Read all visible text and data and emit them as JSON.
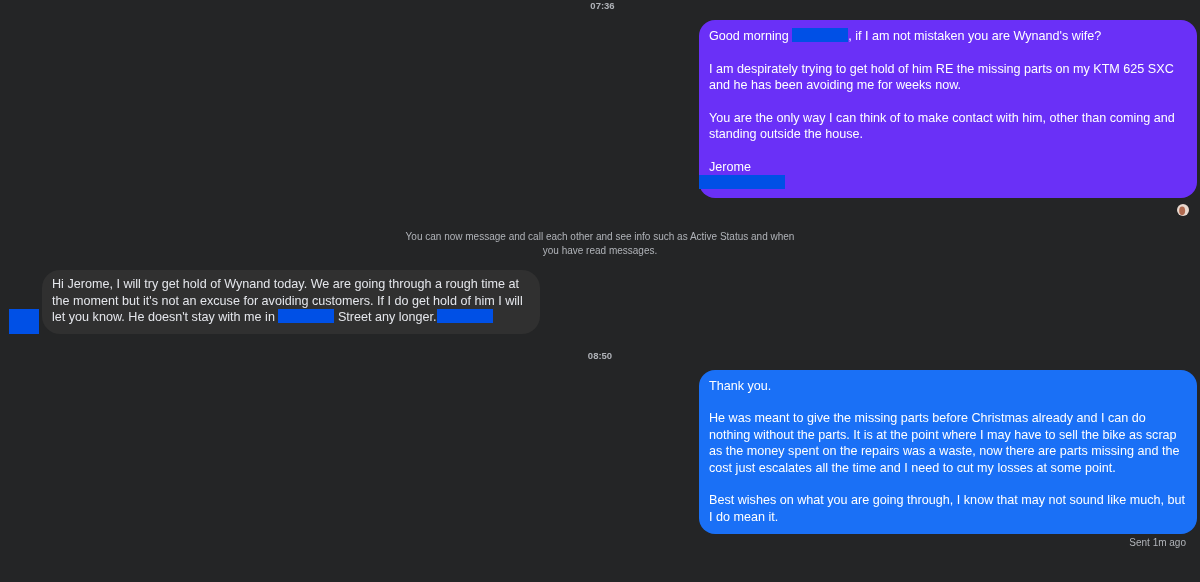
{
  "messages": [
    {
      "kind": "timestamp",
      "text": "07:36"
    },
    {
      "kind": "sent",
      "color": "#6a30f7",
      "paragraphs": [
        [
          {
            "kind": "text",
            "text": "Good morning "
          },
          {
            "kind": "redaction"
          },
          {
            "kind": "text",
            "text": ", if I am not mistaken you are Wynand's wife?"
          }
        ],
        [
          {
            "kind": "text",
            "text": "I am despirately trying to get hold of him RE the missing parts on my KTM 625 SXC and he has been avoiding me for weeks now."
          }
        ],
        [
          {
            "kind": "text",
            "text": "You are the only way I can think of to make contact with him, other than coming and standing outside the house."
          }
        ],
        [
          {
            "kind": "text",
            "text": "Jerome"
          }
        ],
        [
          {
            "kind": "redaction"
          }
        ]
      ]
    },
    {
      "kind": "read_receipt"
    },
    {
      "kind": "notice",
      "text": "You can now message and call each other and see info such as Active Status and when you have read messages."
    },
    {
      "kind": "received",
      "paragraphs": [
        [
          {
            "kind": "text",
            "text": "Hi Jerome, I will try get hold of Wynand today. We are going through a rough time at the moment but it's not an excuse for avoiding customers. If I do get hold of him I will let you know. He doesn't stay with me in "
          },
          {
            "kind": "redaction"
          },
          {
            "kind": "text",
            "text": " Street any longer."
          },
          {
            "kind": "redaction"
          }
        ]
      ]
    },
    {
      "kind": "timestamp",
      "text": "08:50"
    },
    {
      "kind": "sent",
      "color": "#1a70f6",
      "paragraphs": [
        [
          {
            "kind": "text",
            "text": "Thank you."
          }
        ],
        [
          {
            "kind": "text",
            "text": "He was meant to give the missing parts before Christmas already and I can do nothing without the parts. It is at the point where I may have to sell the bike as scrap as the money spent on the repairs was a waste, now there are parts missing and the cost just escalates all the time and I need to cut my losses at some point."
          }
        ],
        [
          {
            "kind": "text",
            "text": "Best wishes on what you are going through, I know that may not sound like much, but I do mean it."
          }
        ]
      ]
    },
    {
      "kind": "status",
      "text": "Sent 1m ago"
    }
  ]
}
